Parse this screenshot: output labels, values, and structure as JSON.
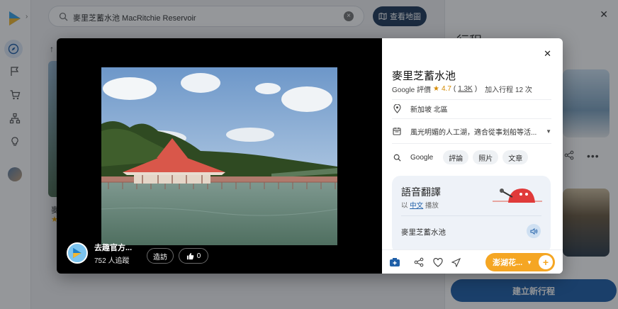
{
  "search": {
    "query": "麥里芝蓄水池 MacRitchie Reservoir",
    "map_button_label": "查看地圖"
  },
  "background": {
    "place_label_partial": "麥",
    "right_panel_title": "行程",
    "new_trip_label": "建立新行程"
  },
  "viewer": {
    "owner_name": "去趣官方...",
    "owner_followers": "752 人追蹤",
    "visit_label": "造訪",
    "like_count": "0"
  },
  "place": {
    "title": "麥里芝蓄水池",
    "rating_source": "Google 評價",
    "rating_value": "4.7",
    "rating_count": "1.3K",
    "trip_count_label": "加入行程 12 次",
    "location": "新加坡 北區",
    "description": "風光明媚的人工湖，適合從事划船等活...",
    "google_label": "Google",
    "chips": [
      "評論",
      "照片",
      "文章"
    ]
  },
  "translate": {
    "title": "語音翻譯",
    "sub_prefix": "以",
    "language": "中文",
    "sub_suffix": "播放",
    "phrase": "麥里芝蓄水池"
  },
  "footer": {
    "trip_select_label": "澎湖花..."
  },
  "colors": {
    "brand_blue": "#1f5fa8",
    "accent_orange": "#f5a623",
    "star": "#d48a00"
  },
  "icons": [
    "search-icon",
    "compass-icon",
    "flag-icon",
    "cart-icon",
    "sitemap-icon",
    "lightbulb-icon",
    "map-icon",
    "close-icon",
    "location-pin-icon",
    "calendar-icon",
    "chevron-down-icon",
    "speaker-icon",
    "camera-plus-icon",
    "share-icon",
    "heart-icon",
    "send-icon",
    "thumbs-up-icon",
    "plus-icon"
  ]
}
